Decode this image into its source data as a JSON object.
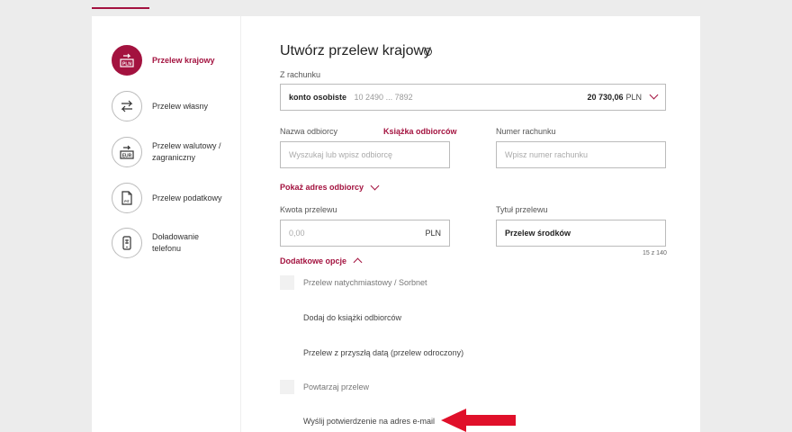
{
  "sidebar": {
    "items": [
      {
        "label": "Przelew krajowy",
        "icon": "pln-transfer-icon",
        "active": true
      },
      {
        "label": "Przelew własny",
        "icon": "own-transfer-icon",
        "active": false
      },
      {
        "label": "Przelew walutowy / zagraniczny",
        "icon": "eur-transfer-icon",
        "active": false
      },
      {
        "label": "Przelew podatkowy",
        "icon": "tax-document-icon",
        "active": false
      },
      {
        "label": "Doładowanie telefonu",
        "icon": "phone-topup-icon",
        "active": false
      }
    ]
  },
  "form": {
    "title": "Utwórz przelew krajowy",
    "from_account": {
      "label": "Z rachunku",
      "name": "konto osobiste",
      "number": "10 2490 ... 7892",
      "balance": "20 730,06",
      "currency": "PLN"
    },
    "recipient": {
      "label": "Nazwa odbiorcy",
      "address_book_link": "Książka odbiorców",
      "placeholder": "Wyszukaj lub wpisz odbiorcę"
    },
    "account_number": {
      "label": "Numer rachunku",
      "placeholder": "Wpisz numer rachunku"
    },
    "show_address_link": "Pokaż adres odbiorcy",
    "amount": {
      "label": "Kwota przelewu",
      "placeholder": "0,00",
      "currency": "PLN"
    },
    "transfer_title": {
      "label": "Tytuł przelewu",
      "value": "Przelew środków",
      "counter": "15 z 140"
    },
    "additional_options_link": "Dodatkowe opcje",
    "options": [
      {
        "label": "Przelew natychmiastowy / Sorbnet",
        "checkbox": true,
        "disabled": true
      },
      {
        "label": "Dodaj do książki odbiorców",
        "checkbox": false,
        "disabled": false
      },
      {
        "label": "Przelew z przyszłą datą (przelew odroczony)",
        "checkbox": false,
        "disabled": false
      },
      {
        "label": "Powtarzaj przelew",
        "checkbox": true,
        "disabled": true
      },
      {
        "label": "Wyślij potwierdzenie na adres e-mail",
        "checkbox": false,
        "disabled": false
      }
    ]
  },
  "colors": {
    "accent": "#a3123f",
    "arrow": "#e0102a"
  }
}
